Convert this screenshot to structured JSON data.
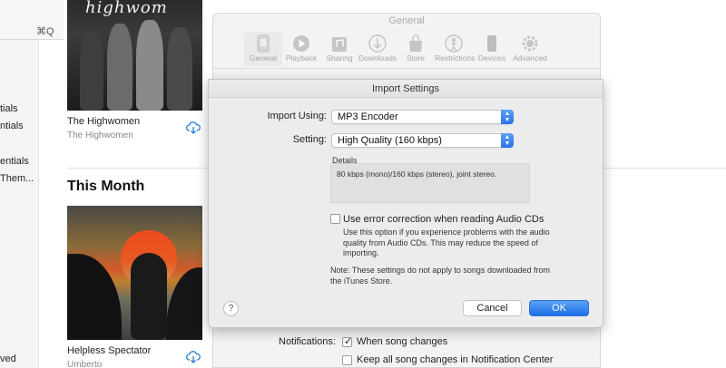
{
  "menu": {
    "shortcut": "⌘Q"
  },
  "sidebar": {
    "items": [
      {
        "label": "tials"
      },
      {
        "label": "ntials"
      },
      {
        "label": "entials"
      },
      {
        "label": "Them..."
      },
      {
        "label": "ved"
      }
    ]
  },
  "library": {
    "albums": [
      {
        "title": "The Highwomen",
        "artist": "The Highwomen",
        "art_logo": "highwom"
      },
      {
        "title": "Helpless Spectator",
        "artist": "Umberto"
      }
    ],
    "section_title": "This Month"
  },
  "prefs": {
    "title": "General",
    "tabs": [
      {
        "label": "General",
        "icon": "general-icon"
      },
      {
        "label": "Playback",
        "icon": "play-icon"
      },
      {
        "label": "Sharing",
        "icon": "sharing-icon"
      },
      {
        "label": "Downloads",
        "icon": "download-icon"
      },
      {
        "label": "Store",
        "icon": "store-icon"
      },
      {
        "label": "Restrictions",
        "icon": "restrictions-icon"
      },
      {
        "label": "Devices",
        "icon": "device-icon"
      },
      {
        "label": "Advanced",
        "icon": "gear-icon"
      }
    ],
    "notifications_label": "Notifications:",
    "notif_options": [
      {
        "label": "When song changes",
        "checked": true
      },
      {
        "label": "Keep all song changes in Notification Center",
        "checked": false
      }
    ]
  },
  "sheet": {
    "title": "Import Settings",
    "import_using_label": "Import Using:",
    "import_using_value": "MP3 Encoder",
    "setting_label": "Setting:",
    "setting_value": "High Quality (160 kbps)",
    "details_label": "Details",
    "details_text": "80 kbps (mono)/160 kbps (stereo), joint stereo.",
    "error_correction_label": "Use error correction when reading Audio CDs",
    "error_correction_checked": false,
    "error_help": "Use this option if you experience problems with the audio quality from Audio CDs. This may reduce the speed of importing.",
    "note": "Note: These settings do not apply to songs downloaded from the iTunes Store.",
    "help_button": "?",
    "cancel_label": "Cancel",
    "ok_label": "OK"
  },
  "colors": {
    "accent": "#2a73e6",
    "download": "#2d7fd8"
  }
}
